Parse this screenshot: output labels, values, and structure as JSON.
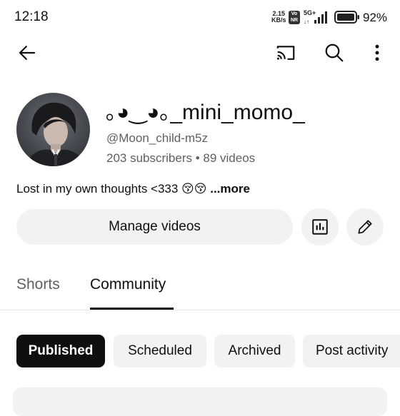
{
  "status_bar": {
    "time": "12:18",
    "net_speed_value": "2.15",
    "net_speed_unit": "KB/s",
    "volte_line1": "Vo",
    "volte_line2": "NR",
    "network_type": "5G+",
    "battery_percent": "92%",
    "battery_level": 0.92
  },
  "top_bar": {
    "icons": [
      "back-arrow-icon",
      "cast-icon",
      "search-icon",
      "more-vert-icon"
    ]
  },
  "channel": {
    "name": "｡◕‿◕｡_mini_momo_",
    "handle": "@Moon_child-m5z",
    "stats": "203 subscribers • 89 videos",
    "description": "Lost in my own thoughts <333 😚😚 ",
    "more_label": "...more"
  },
  "actions": {
    "manage_videos": "Manage videos",
    "analytics_icon": "analytics-icon",
    "edit_icon": "pencil-icon"
  },
  "tabs": [
    {
      "label": "Shorts",
      "selected": false
    },
    {
      "label": "Community",
      "selected": true
    }
  ],
  "chips": [
    {
      "label": "Published",
      "selected": true
    },
    {
      "label": "Scheduled",
      "selected": false
    },
    {
      "label": "Archived",
      "selected": false
    },
    {
      "label": "Post activity",
      "selected": false
    }
  ],
  "colors": {
    "text_primary": "#0f0f0f",
    "text_secondary": "#606060",
    "chip_bg": "#f2f2f2",
    "chip_selected_bg": "#0f0f0f"
  }
}
